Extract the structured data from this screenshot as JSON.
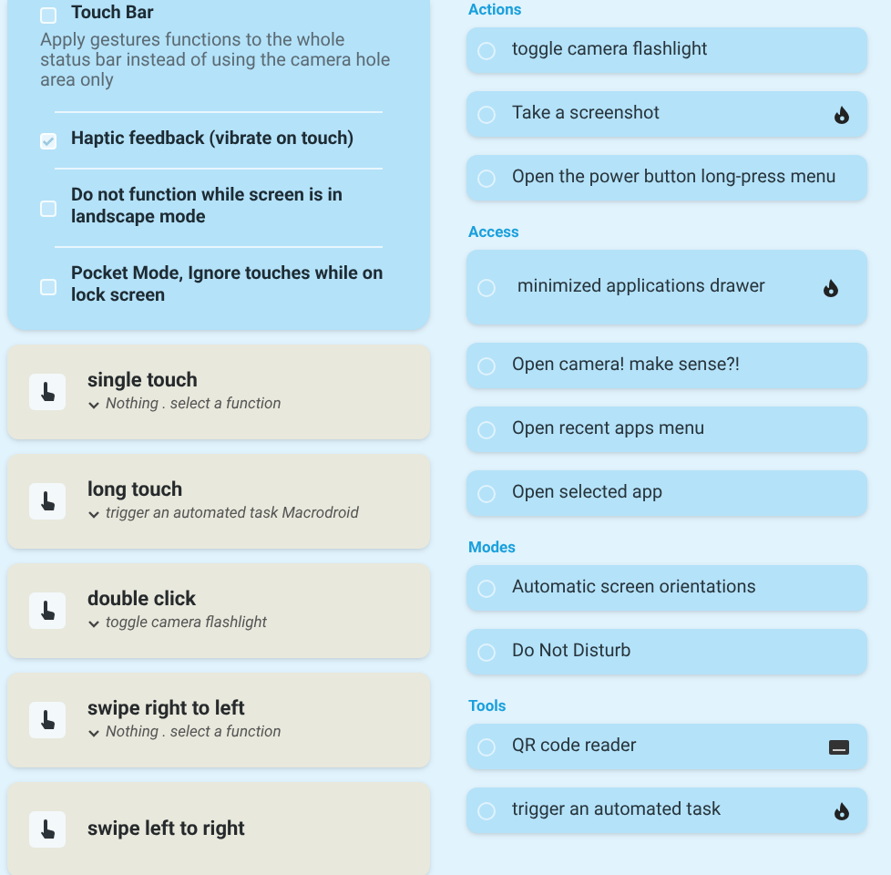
{
  "settings": [
    {
      "label": "Touch Bar",
      "checked": false,
      "description": "Apply gestures functions to the whole status bar instead of using the camera hole area only"
    },
    {
      "label": "Haptic feedback (vibrate on touch)",
      "checked": true
    },
    {
      "label": "Do not function while screen is in landscape mode",
      "checked": false
    },
    {
      "label": "Pocket Mode, Ignore touches while on lock screen",
      "checked": false
    }
  ],
  "gestures": [
    {
      "name": "single touch",
      "action": "Nothing . select a function"
    },
    {
      "name": "long touch",
      "action": "trigger an automated task Macrodroid"
    },
    {
      "name": "double click",
      "action": "toggle camera flashlight"
    },
    {
      "name": "swipe right to left",
      "action": "Nothing . select a function"
    },
    {
      "name": "swipe left to right"
    }
  ],
  "function_groups": [
    {
      "title": "Actions",
      "items": [
        {
          "label": "toggle camera flashlight",
          "selected": false
        },
        {
          "label": "Take a screenshot",
          "selected": false,
          "flame": true
        },
        {
          "label": "Open the power button long-press menu",
          "selected": false
        }
      ]
    },
    {
      "title": "Access",
      "items": [
        {
          "label": "minimized applications drawer",
          "selected": false,
          "flame": true,
          "tall": true
        },
        {
          "label": "Open camera! make sense?!",
          "selected": false
        },
        {
          "label": "Open recent apps menu",
          "selected": false
        },
        {
          "label": "Open selected app",
          "selected": false
        }
      ]
    },
    {
      "title": "Modes",
      "items": [
        {
          "label": "Automatic screen orientations",
          "selected": false
        },
        {
          "label": "Do Not Disturb",
          "selected": false
        }
      ]
    },
    {
      "title": "Tools",
      "items": [
        {
          "label": "QR code reader",
          "selected": false,
          "keyboard": true
        },
        {
          "label": "trigger an automated task",
          "selected": false,
          "flame": true
        }
      ]
    }
  ]
}
